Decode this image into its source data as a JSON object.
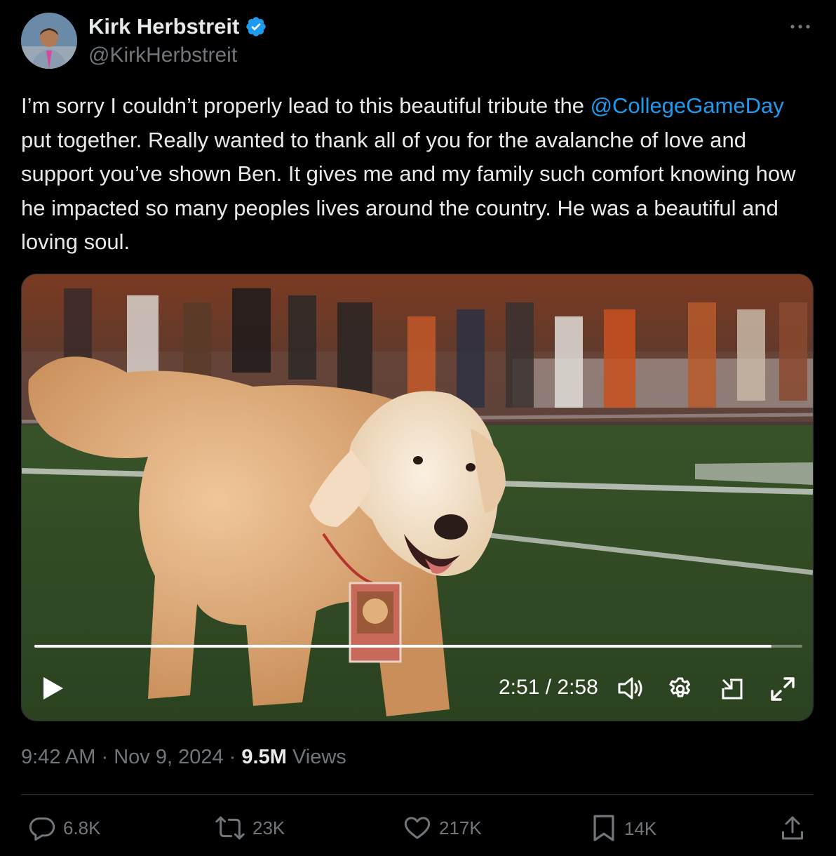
{
  "author": {
    "name": "Kirk Herbstreit",
    "handle": "@KirkHerbstreit",
    "verified": true
  },
  "more_icon": "more-horizontal-icon",
  "post": {
    "text_before": "I’m sorry I couldn’t properly lead to this beautiful tribute the ",
    "mention": "@CollegeGameDay",
    "text_after": " put together. Really wanted to thank all of you for the avalanche of love and support you’ve shown Ben. It gives me and my family such comfort knowing how he impacted so many peoples lives around the country. He was a beautiful and loving soul."
  },
  "video": {
    "time_display": "2:51 / 2:58",
    "progress": 0.96,
    "icons": [
      "play-icon",
      "volume-icon",
      "settings-icon",
      "pip-icon",
      "fullscreen-icon"
    ]
  },
  "meta": {
    "time": "9:42 AM",
    "separator": "·",
    "date": "Nov 9, 2024",
    "views_count": "9.5M",
    "views_label": "Views"
  },
  "actions": {
    "replies": "6.8K",
    "reposts": "23K",
    "likes": "217K",
    "bookmarks": "14K"
  },
  "colors": {
    "background": "#000000",
    "text": "#e7e9ea",
    "secondary": "#71767b",
    "accent": "#1d9bf0"
  }
}
